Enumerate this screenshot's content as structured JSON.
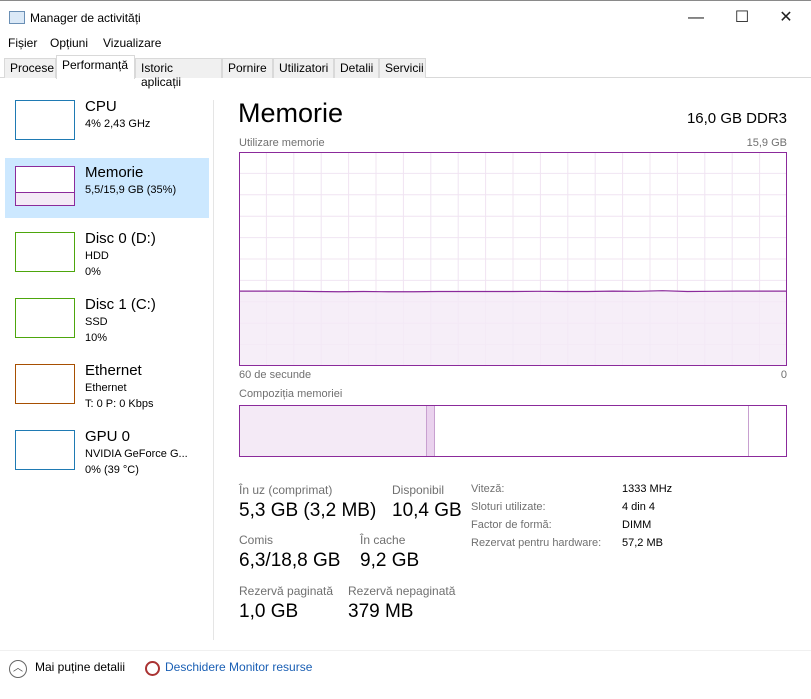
{
  "window": {
    "title": "Manager de activități",
    "minimize": "—",
    "maximize": "☐",
    "close": "✕"
  },
  "menu": [
    "Fișier",
    "Opțiuni",
    "Vizualizare"
  ],
  "tabs": [
    "Procese",
    "Performanță",
    "Istoric aplicații",
    "Pornire",
    "Utilizatori",
    "Detalii",
    "Servicii"
  ],
  "sidebar": [
    {
      "name": "CPU",
      "line1": "4% 2,43 GHz",
      "line2": "",
      "color": "#1f7ab3"
    },
    {
      "name": "Memorie",
      "line1": "5,5/15,9 GB (35%)",
      "line2": "",
      "color": "#8b2a9b"
    },
    {
      "name": "Disc 0 (D:)",
      "line1": "HDD",
      "line2": "0%",
      "color": "#4da60c"
    },
    {
      "name": "Disc 1 (C:)",
      "line1": "SSD",
      "line2": "10%",
      "color": "#4da60c"
    },
    {
      "name": "Ethernet",
      "line1": "Ethernet",
      "line2": "T: 0 P: 0 Kbps",
      "color": "#a74f01"
    },
    {
      "name": "GPU 0",
      "line1": "NVIDIA GeForce G...",
      "line2": "0% (39 °C)",
      "color": "#1f7ab3"
    }
  ],
  "main": {
    "title": "Memorie",
    "spec": "16,0 GB DDR3",
    "usage_label": "Utilizare memorie",
    "usage_max": "15,9 GB",
    "time_left": "60 de secunde",
    "time_right": "0",
    "composition_label": "Compoziția memoriei",
    "stats": [
      {
        "label": "În uz (comprimat)",
        "value": "5,3 GB (3,2 MB)"
      },
      {
        "label": "Disponibil",
        "value": "10,4 GB"
      },
      {
        "label": "Comis",
        "value": "6,3/18,8 GB"
      },
      {
        "label": "În cache",
        "value": "9,2 GB"
      },
      {
        "label": "Rezervă paginată",
        "value": "1,0 GB"
      },
      {
        "label": "Rezervă nepaginată",
        "value": "379 MB"
      }
    ],
    "specs": [
      {
        "key": "Viteză:",
        "value": "1333 MHz"
      },
      {
        "key": "Sloturi utilizate:",
        "value": "4 din 4"
      },
      {
        "key": "Factor de formă:",
        "value": "DIMM"
      },
      {
        "key": "Rezervat pentru hardware:",
        "value": "57,2 MB"
      }
    ]
  },
  "chart_data": {
    "type": "area",
    "title": "Utilizare memorie",
    "ylim": [
      0,
      15.9
    ],
    "xlabel": "60 de secunde",
    "usage_percent": [
      35,
      35,
      35,
      34.8,
      34.7,
      34.8,
      34.7,
      34.7,
      34.8,
      34.8,
      34.8,
      34.8,
      34.9,
      34.8,
      34.8,
      35,
      34.9,
      35.2,
      34.8,
      34.9,
      35,
      35,
      35
    ],
    "composition_percent": {
      "in_use": 34,
      "modified": 1.5,
      "standby": 57.5,
      "free": 7
    }
  },
  "footer": {
    "fewer": "Mai puține detalii",
    "monitor": "Deschidere Monitor resurse"
  }
}
